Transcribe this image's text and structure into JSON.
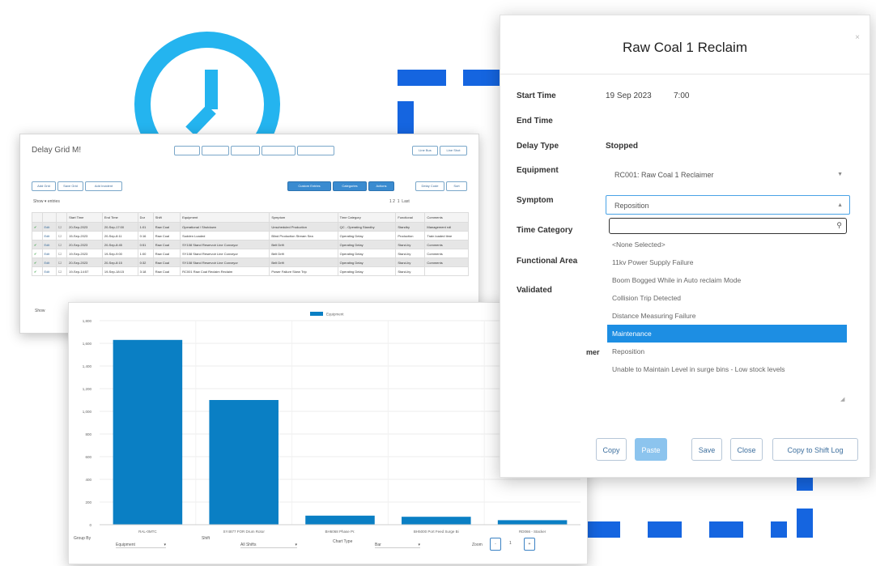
{
  "clock": {
    "icon": "clock-icon",
    "color": "#24b4ef"
  },
  "connector": {
    "color": "#1565e0"
  },
  "grid_window": {
    "title": "Delay Grid M!",
    "toolbar_right": [
      "Line Bus",
      "Line Shot"
    ],
    "toolbar_left": [
      "Add Grid",
      "Save Grid",
      "Add Incident"
    ],
    "toolbar_blue": [
      "Custom Entries",
      "Categories",
      "Actions"
    ],
    "toolbar_blue_tail": [
      "Delay Code",
      "Sort"
    ],
    "show_label": "Show",
    "entries_label": "entries",
    "pagination": [
      "1 2",
      "1",
      "Last"
    ],
    "columns": [
      "",
      "",
      "",
      "Start Time",
      "End Time",
      "Dur",
      "Shift",
      "Equipment",
      "Symptom",
      "Time Category",
      "Functional",
      "Comments"
    ],
    "rows": [
      [
        "✔",
        "Edit",
        "☐",
        "20-Sep-2023",
        "20-Sep-17:00",
        "1:01",
        "Raw Coal",
        "Operational / Shutdown",
        "Unscheduled Production",
        "QC - Operating Standby",
        "Standby",
        "Management roll"
      ],
      [
        "",
        "Edit",
        "☐",
        "15-Sep-2023",
        "20-Sep-8:11",
        "0:16",
        "Raw Coal",
        "Sudden Loaded",
        "Blind Production Stream Sea",
        "Operating Delay",
        "Production",
        "Train loaded time"
      ],
      [
        "✔",
        "Edit",
        "☐",
        "20-Sep-2023",
        "20-Sep-8:45",
        "0:51",
        "Raw Coal",
        "SY108 Stand Reservoir Line Conveyor",
        "Belt Drift",
        "Operating Delay",
        "Stand-by",
        "Comments"
      ],
      [
        "✔",
        "Edit",
        "☐",
        "19-Sep-2023",
        "19-Sep-9:00",
        "1:00",
        "Raw Coal",
        "SY108 Stand Reservoir Line Conveyor",
        "Belt Drift",
        "Operating Delay",
        "Stand-by",
        "Comments"
      ],
      [
        "✔",
        "Edit",
        "☐",
        "20-Sep-2023",
        "20-Sep-8:15",
        "0:32",
        "Raw Coal",
        "SY108 Stand Reservoir Line Conveyor",
        "Belt Drift",
        "Operating Delay",
        "Stand-by",
        "Comments"
      ],
      [
        "✔",
        "Edit",
        "☐",
        "19-Sep-14:57",
        "19-Sep-18:15",
        "3:18",
        "Raw Coal",
        "RC001 Raw Coal Reclaim Reclaim",
        "Power Failure Skew Trip",
        "Operating Delay",
        "Stand-by",
        ""
      ]
    ],
    "footer": "Show"
  },
  "chart_window": {
    "footer": {
      "group_by_label": "Group By",
      "group_by_value": "Equipment",
      "shift_label": "Shift",
      "shift_value": "All Shifts",
      "chart_type_label": "Chart Type",
      "chart_type_value": "Bar",
      "zoom_label": "Zoom",
      "zoom_minus": "-",
      "zoom_value": "1",
      "zoom_plus": "+"
    }
  },
  "chart_data": {
    "type": "bar",
    "categories": [
      "RAL-0MTC",
      "SY4877 FOR Drum Rotor",
      "BH6068 Phase Pr.",
      "BH5000 Port Feed Surge Bi",
      "RD066 - Stacker"
    ],
    "series": [
      {
        "name": "Equipment",
        "values": [
          1630,
          1100,
          80,
          70,
          40
        ]
      }
    ],
    "ylim": [
      0,
      1800
    ],
    "yticks": [
      0,
      200,
      400,
      600,
      800,
      1000,
      1200,
      1400,
      1600,
      1800
    ],
    "ytick_labels": [
      "0",
      "200",
      "400",
      "600",
      "800",
      "1,000",
      "1,200",
      "1,400",
      "1,600",
      "1,800"
    ],
    "bar_color": "#0a7fc4",
    "legend": "top-center",
    "grid": true
  },
  "modal": {
    "title": "Raw Coal 1 Reclaim",
    "close": "×",
    "fields": {
      "start_time_label": "Start Time",
      "start_date": "19 Sep 2023",
      "start_clock": "7:00",
      "end_time_label": "End Time",
      "delay_type_label": "Delay Type",
      "delay_type_value": "Stopped",
      "equipment_label": "Equipment",
      "equipment_value": "RC001: Raw Coal 1 Reclaimer",
      "symptom_label": "Symptom",
      "symptom_value": "Reposition",
      "time_category_label": "Time Category",
      "functional_area_label": "Functional Area",
      "validated_label": "Validated",
      "comment_label_fragment": "mer"
    },
    "dropdown": {
      "search_value": "",
      "options": [
        "<None Selected>",
        "11kv Power Supply Failure",
        "Boom Bogged While in Auto reclaim Mode",
        "Collision Trip Detected",
        "Distance Measuring Failure",
        "Maintenance",
        "Reposition",
        "Unable to Maintain Level in surge bins - Low stock levels"
      ],
      "highlighted": "Maintenance"
    },
    "buttons": [
      "Copy",
      "Paste",
      "Save",
      "Close",
      "Copy to Shift Log"
    ]
  }
}
